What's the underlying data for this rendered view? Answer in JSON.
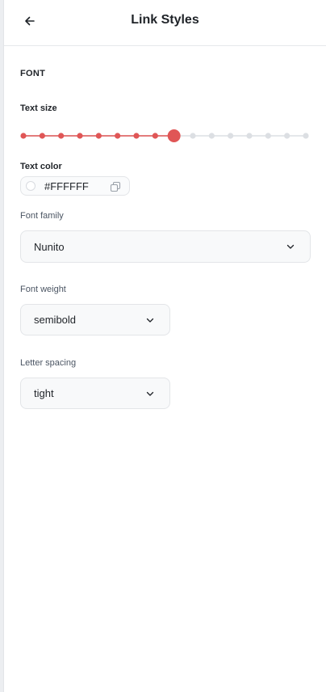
{
  "header": {
    "title": "Link Styles",
    "back_icon": "arrow-left-icon"
  },
  "font_section": {
    "label": "FONT",
    "text_size": {
      "label": "Text size",
      "steps": 16,
      "selected_index": 8,
      "accent": "#e05656",
      "inactive": "#dcdfe3"
    },
    "text_color": {
      "label": "Text color",
      "value": "#FFFFFF",
      "swatch_color": "#ffffff",
      "copy_icon": "copy-icon"
    },
    "font_family": {
      "label": "Font family",
      "value": "Nunito"
    },
    "font_weight": {
      "label": "Font weight",
      "value": "semibold"
    },
    "letter_spacing": {
      "label": "Letter spacing",
      "value": "tight"
    }
  }
}
